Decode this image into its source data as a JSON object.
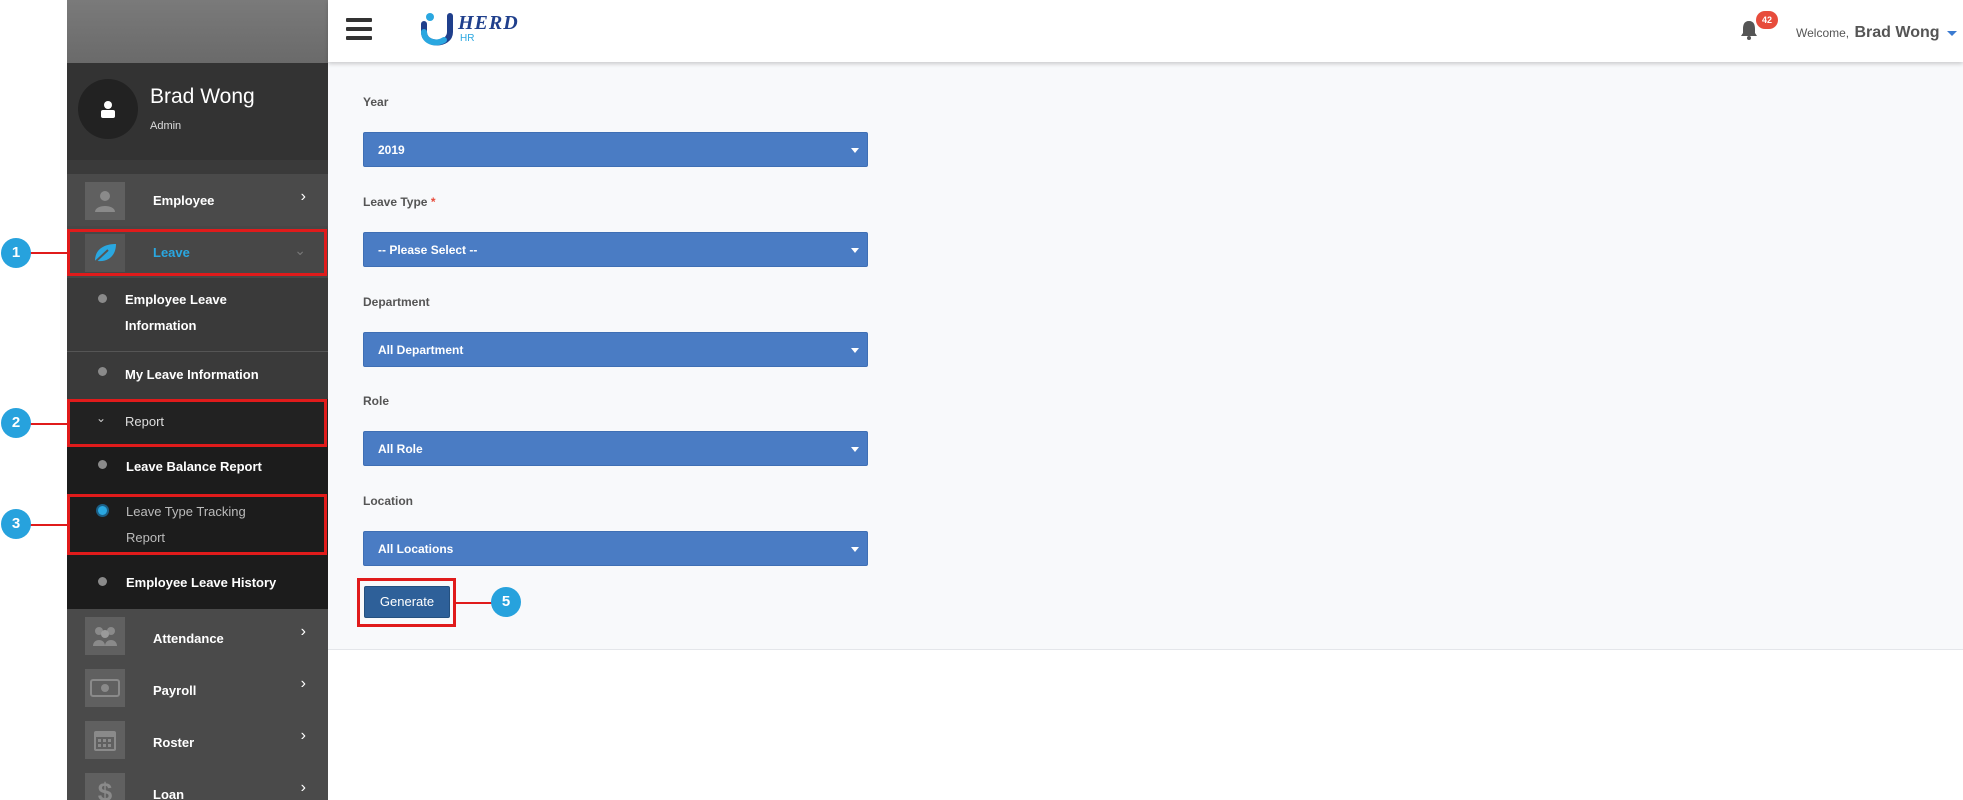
{
  "header": {
    "logo_main": "HERD",
    "logo_sub": "HR",
    "notification_count": "42",
    "welcome_label": "Welcome,",
    "user_name": "Brad Wong"
  },
  "profile": {
    "name": "Brad Wong",
    "role": "Admin"
  },
  "sidebar": {
    "employee": "Employee",
    "leave": "Leave",
    "leave_sub": {
      "employee_leave_info_line1": "Employee Leave",
      "employee_leave_info_line2": "Information",
      "my_leave_info": "My Leave Information",
      "report": "Report",
      "leave_balance_report": "Leave Balance Report",
      "leave_type_tracking_line1": "Leave Type Tracking",
      "leave_type_tracking_line2": "Report",
      "employee_leave_history": "Employee Leave History"
    },
    "attendance": "Attendance",
    "payroll": "Payroll",
    "roster": "Roster",
    "loan": "Loan"
  },
  "form": {
    "year_label": "Year",
    "year_value": "2019",
    "leave_type_label": "Leave Type",
    "leave_type_required": "*",
    "leave_type_value": "-- Please Select --",
    "department_label": "Department",
    "department_value": "All Department",
    "role_label": "Role",
    "role_value": "All Role",
    "location_label": "Location",
    "location_value": "All Locations",
    "generate_label": "Generate"
  },
  "annotations": {
    "m1": "1",
    "m2": "2",
    "m3": "3",
    "m5": "5",
    "color": "#e01b1b",
    "marker_color": "#27a2dd"
  },
  "colors": {
    "select_bg": "#4a7cc4",
    "button_bg": "#2e6099",
    "active_leave": "#2aa7e0"
  }
}
